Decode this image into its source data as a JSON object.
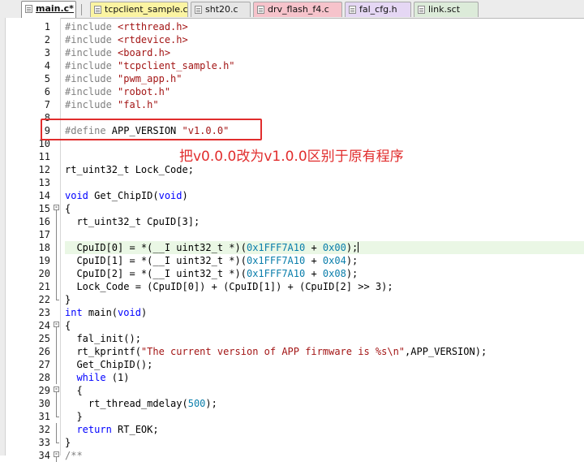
{
  "tabs": [
    {
      "label": "main.c*",
      "color": "#ffffff",
      "active": true
    },
    {
      "label": "tcpclient_sample.c",
      "color": "#fbf4a2"
    },
    {
      "label": "sht20.c",
      "color": "#e6e6e6"
    },
    {
      "label": "drv_flash_f4.c",
      "color": "#f6c3cb"
    },
    {
      "label": "fal_cfg.h",
      "color": "#e5d7f4"
    },
    {
      "label": "link.sct",
      "color": "#dcebd9"
    }
  ],
  "annotation": {
    "text": "把v0.0.0改为v1.0.0区别于原有程序",
    "color": "#e12d2d"
  },
  "editor": {
    "lines": [
      {
        "n": "1",
        "code": [
          {
            "t": "#include ",
            "c": "pp"
          },
          {
            "t": "<rtthread.h>",
            "c": "str"
          }
        ]
      },
      {
        "n": "2",
        "code": [
          {
            "t": "#include ",
            "c": "pp"
          },
          {
            "t": "<rtdevice.h>",
            "c": "str"
          }
        ]
      },
      {
        "n": "3",
        "code": [
          {
            "t": "#include ",
            "c": "pp"
          },
          {
            "t": "<board.h>",
            "c": "str"
          }
        ]
      },
      {
        "n": "4",
        "code": [
          {
            "t": "#include ",
            "c": "pp"
          },
          {
            "t": "\"tcpclient_sample.h\"",
            "c": "str"
          }
        ]
      },
      {
        "n": "5",
        "code": [
          {
            "t": "#include ",
            "c": "pp"
          },
          {
            "t": "\"pwm_app.h\"",
            "c": "str"
          }
        ]
      },
      {
        "n": "6",
        "code": [
          {
            "t": "#include ",
            "c": "pp"
          },
          {
            "t": "\"robot.h\"",
            "c": "str"
          }
        ]
      },
      {
        "n": "7",
        "code": [
          {
            "t": "#include ",
            "c": "pp"
          },
          {
            "t": "\"fal.h\"",
            "c": "str"
          }
        ]
      },
      {
        "n": "8",
        "code": []
      },
      {
        "n": "9",
        "code": [
          {
            "t": "#define ",
            "c": "pp"
          },
          {
            "t": "APP_VERSION ",
            "c": ""
          },
          {
            "t": "\"v1.0.0\"",
            "c": "str"
          }
        ]
      },
      {
        "n": "10",
        "code": []
      },
      {
        "n": "11",
        "code": []
      },
      {
        "n": "12",
        "code": [
          {
            "t": "rt_uint32_t Lock_Code;",
            "c": ""
          }
        ]
      },
      {
        "n": "13",
        "code": []
      },
      {
        "n": "14",
        "code": [
          {
            "t": "void",
            "c": "kw"
          },
          {
            "t": " Get_ChipID(",
            "c": ""
          },
          {
            "t": "void",
            "c": "kw"
          },
          {
            "t": ")",
            "c": ""
          }
        ]
      },
      {
        "n": "15",
        "fold": "open",
        "code": [
          {
            "t": "{",
            "c": ""
          }
        ]
      },
      {
        "n": "16",
        "fold": "mid",
        "code": [
          {
            "t": "  rt_uint32_t CpuID[3];",
            "c": ""
          }
        ]
      },
      {
        "n": "17",
        "fold": "mid",
        "code": []
      },
      {
        "n": "18",
        "fold": "mid",
        "highlight": true,
        "caret": true,
        "code": [
          {
            "t": "  CpuID[0] = *(__I uint32_t *)(",
            "c": ""
          },
          {
            "t": "0x1FFF7A10",
            "c": "num"
          },
          {
            "t": " + ",
            "c": ""
          },
          {
            "t": "0x00",
            "c": "num"
          },
          {
            "t": ");",
            "c": ""
          }
        ]
      },
      {
        "n": "19",
        "fold": "mid",
        "code": [
          {
            "t": "  CpuID[1] = *(__I uint32_t *)(",
            "c": ""
          },
          {
            "t": "0x1FFF7A10",
            "c": "num"
          },
          {
            "t": " + ",
            "c": ""
          },
          {
            "t": "0x04",
            "c": "num"
          },
          {
            "t": ");",
            "c": ""
          }
        ]
      },
      {
        "n": "20",
        "fold": "mid",
        "code": [
          {
            "t": "  CpuID[2] = *(__I uint32_t *)(",
            "c": ""
          },
          {
            "t": "0x1FFF7A10",
            "c": "num"
          },
          {
            "t": " + ",
            "c": ""
          },
          {
            "t": "0x08",
            "c": "num"
          },
          {
            "t": ");",
            "c": ""
          }
        ]
      },
      {
        "n": "21",
        "fold": "mid",
        "code": [
          {
            "t": "  Lock_Code = (CpuID[0]) + (CpuID[1]) + (CpuID[2] >> 3);",
            "c": ""
          }
        ]
      },
      {
        "n": "22",
        "fold": "end",
        "code": [
          {
            "t": "}",
            "c": ""
          }
        ]
      },
      {
        "n": "23",
        "code": [
          {
            "t": "int",
            "c": "kw"
          },
          {
            "t": " main(",
            "c": ""
          },
          {
            "t": "void",
            "c": "kw"
          },
          {
            "t": ")",
            "c": ""
          }
        ]
      },
      {
        "n": "24",
        "fold": "open",
        "code": [
          {
            "t": "{",
            "c": ""
          }
        ]
      },
      {
        "n": "25",
        "fold": "mid",
        "code": [
          {
            "t": "  fal_init();",
            "c": ""
          }
        ]
      },
      {
        "n": "26",
        "fold": "mid",
        "code": [
          {
            "t": "  rt_kprintf(",
            "c": ""
          },
          {
            "t": "\"The current version of APP firmware is %s\\n\"",
            "c": "str"
          },
          {
            "t": ",APP_VERSION);",
            "c": ""
          }
        ]
      },
      {
        "n": "27",
        "fold": "mid",
        "code": [
          {
            "t": "  Get_ChipID();",
            "c": ""
          }
        ]
      },
      {
        "n": "28",
        "fold": "mid",
        "code": [
          {
            "t": "  ",
            "c": ""
          },
          {
            "t": "while",
            "c": "kw"
          },
          {
            "t": " (1)",
            "c": ""
          }
        ]
      },
      {
        "n": "29",
        "fold": "open",
        "code": [
          {
            "t": "  {",
            "c": ""
          }
        ]
      },
      {
        "n": "30",
        "fold": "mid",
        "code": [
          {
            "t": "    rt_thread_mdelay(",
            "c": ""
          },
          {
            "t": "500",
            "c": "num"
          },
          {
            "t": ");",
            "c": ""
          }
        ]
      },
      {
        "n": "31",
        "fold": "end",
        "code": [
          {
            "t": "  }",
            "c": ""
          }
        ]
      },
      {
        "n": "32",
        "fold": "mid",
        "code": [
          {
            "t": "  ",
            "c": ""
          },
          {
            "t": "return",
            "c": "kw"
          },
          {
            "t": " RT_EOK;",
            "c": ""
          }
        ]
      },
      {
        "n": "33",
        "fold": "end",
        "code": [
          {
            "t": "}",
            "c": ""
          }
        ]
      },
      {
        "n": "34",
        "fold": "open",
        "code": [
          {
            "t": "/**",
            "c": "pp"
          }
        ]
      }
    ]
  }
}
